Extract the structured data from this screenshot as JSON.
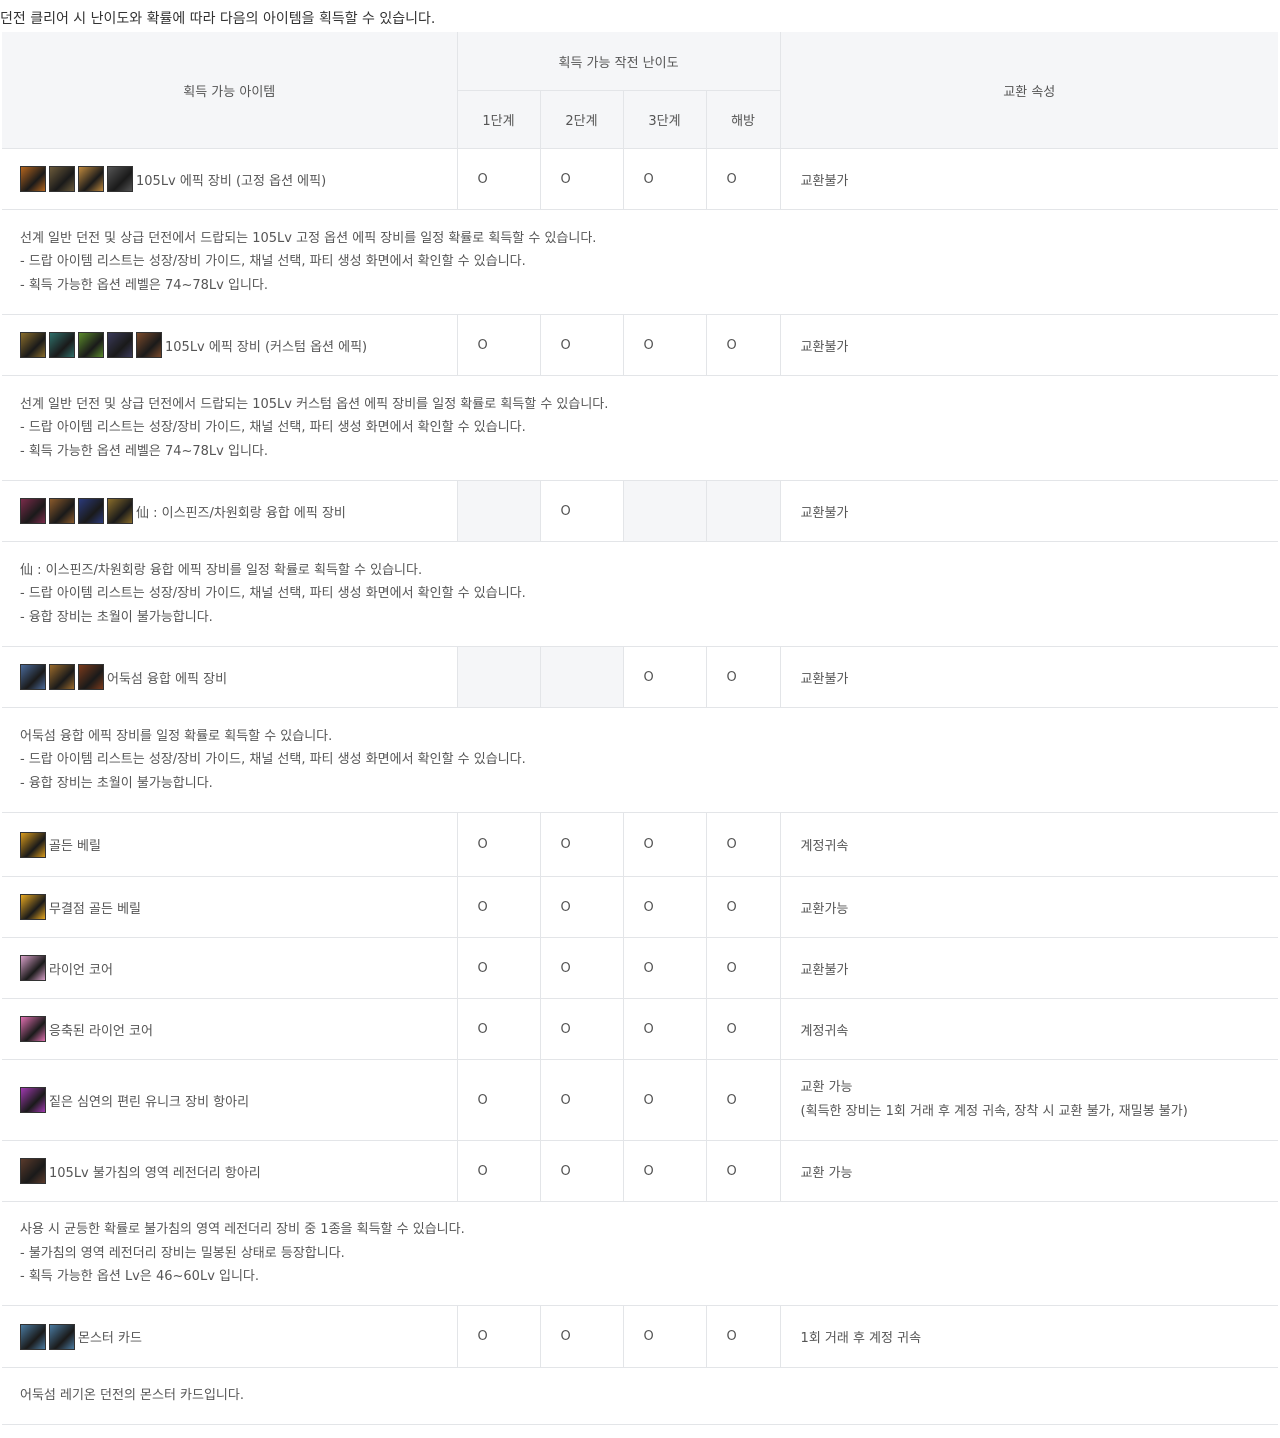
{
  "intro": "던전 클리어 시 난이도와 확률에 따라 다음의 아이템을 획득할 수 있습니다.",
  "header": {
    "item": "획득 가능 아이템",
    "difficulty": "획득 가능 작전 난이도",
    "d1": "1단계",
    "d2": "2단계",
    "d3": "3단계",
    "d4": "해방",
    "trade": "교환 속성"
  },
  "rows": [
    {
      "name": "105Lv 에픽 장비 (고정 옵션 에픽)",
      "icons": [
        "#b5651d",
        "#6b5a3a",
        "#c08a3e",
        "#555555"
      ],
      "d1": "O",
      "d2": "O",
      "d3": "O",
      "d4": "O",
      "trade": "교환불가",
      "desc": [
        "선계 일반 던전 및 상급 던전에서 드랍되는 105Lv 고정 옵션 에픽 장비를 일정 확률로 획득할 수 있습니다.",
        "- 드랍 아이템 리스트는 성장/장비 가이드, 채널 선택, 파티 생성 화면에서 확인할 수 있습니다.",
        "- 획득 가능한 옵션 레벨은 74~78Lv 입니다."
      ]
    },
    {
      "name": "105Lv 에픽 장비 (커스텀 옵션 에픽)",
      "icons": [
        "#8a6d2b",
        "#2f6f6a",
        "#5a8a2b",
        "#3a3a5a",
        "#7a4a2b"
      ],
      "d1": "O",
      "d2": "O",
      "d3": "O",
      "d4": "O",
      "trade": "교환불가",
      "desc": [
        "선계 일반 던전 및 상급 던전에서 드랍되는 105Lv 커스텀 옵션 에픽 장비를 일정 확률로 획득할 수 있습니다.",
        "- 드랍 아이템 리스트는 성장/장비 가이드, 채널 선택, 파티 생성 화면에서 확인할 수 있습니다.",
        "- 획득 가능한 옵션 레벨은 74~78Lv 입니다."
      ]
    },
    {
      "name": "仙 : 이스핀즈/차원회랑 융합 에픽 장비",
      "icons": [
        "#7a2b4a",
        "#8a5a2b",
        "#2b3a7a",
        "#8a6d2b"
      ],
      "d1": "",
      "d2": "O",
      "d3": "",
      "d4": "",
      "na": [
        true,
        false,
        true,
        true
      ],
      "trade": "교환불가",
      "desc": [
        "仙 : 이스핀즈/차원회랑 융합 에픽 장비를 일정 확률로 획득할 수 있습니다.",
        "- 드랍 아이템 리스트는 성장/장비 가이드, 채널 선택, 파티 생성 화면에서 확인할 수 있습니다.",
        "- 융합 장비는 초월이 불가능합니다."
      ]
    },
    {
      "name": "어둑섬 융합 에픽 장비",
      "icons": [
        "#4a6a9a",
        "#9a6a2b",
        "#7a3a1b"
      ],
      "d1": "",
      "d2": "",
      "d3": "O",
      "d4": "O",
      "na": [
        true,
        true,
        false,
        false
      ],
      "trade": "교환불가",
      "desc": [
        "어둑섬 융합 에픽 장비를 일정 확률로 획득할 수 있습니다.",
        "- 드랍 아이템 리스트는 성장/장비 가이드, 채널 선택, 파티 생성 화면에서 확인할 수 있습니다.",
        "- 융합 장비는 초월이 불가능합니다."
      ]
    },
    {
      "name": "골든 베릴",
      "icons": [
        "#d99a1b"
      ],
      "d1": "O",
      "d2": "O",
      "d3": "O",
      "d4": "O",
      "trade": "계정귀속"
    },
    {
      "name": "무결점 골든 베릴",
      "icons": [
        "#e8a820"
      ],
      "d1": "O",
      "d2": "O",
      "d3": "O",
      "d4": "O",
      "trade": "교환가능"
    },
    {
      "name": "라이언 코어",
      "icons": [
        "#d8a0c8"
      ],
      "d1": "O",
      "d2": "O",
      "d3": "O",
      "d4": "O",
      "trade": "교환불가"
    },
    {
      "name": "응축된 라이언 코어",
      "icons": [
        "#e070b0"
      ],
      "d1": "O",
      "d2": "O",
      "d3": "O",
      "d4": "O",
      "trade": "계정귀속"
    },
    {
      "name": "짙은 심연의 편린 유니크 장비 항아리",
      "icons": [
        "#a03ab0"
      ],
      "d1": "O",
      "d2": "O",
      "d3": "O",
      "d4": "O",
      "trade": "교환 가능",
      "trade2": "(획득한 장비는 1회 거래 후 계정 귀속, 장착 시 교환 불가, 재밀봉 불가)"
    },
    {
      "name": "105Lv 불가침의 영역 레전더리 항아리",
      "icons": [
        "#5a3a2b"
      ],
      "d1": "O",
      "d2": "O",
      "d3": "O",
      "d4": "O",
      "trade": "교환 가능",
      "desc": [
        "사용 시 균등한 확률로 불가침의 영역 레전더리 장비 중 1종을 획득할 수 있습니다.",
        "- 불가침의 영역 레전더리 장비는 밀봉된 상태로 등장합니다.",
        "- 획득 가능한 옵션 Lv은 46~60Lv 입니다."
      ]
    },
    {
      "name": "몬스터 카드",
      "icons": [
        "#4a7aa0",
        "#4a7aa0"
      ],
      "d1": "O",
      "d2": "O",
      "d3": "O",
      "d4": "O",
      "trade": "1회 거래 후 계정 귀속",
      "desc": [
        "어둑섬 레기온 던전의 몬스터 카드입니다."
      ]
    }
  ]
}
